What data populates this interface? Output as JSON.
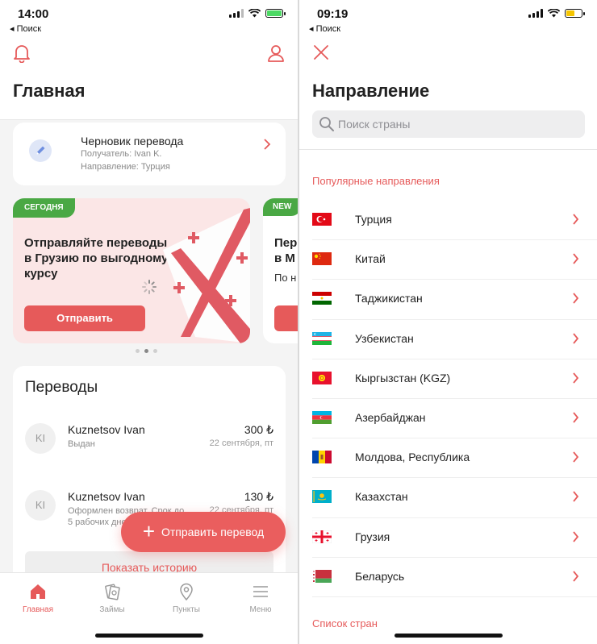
{
  "colors": {
    "accent": "#e65a5a",
    "green_badge": "#4aa844",
    "muted": "#8a8a8a"
  },
  "left": {
    "status": {
      "time": "14:00",
      "back": "◂ Поиск"
    },
    "header": {
      "title": "Главная"
    },
    "draft": {
      "title": "Черновик перевода",
      "recipient": "Получатель: Ivan K.",
      "direction": "Направление: Турция"
    },
    "promo": {
      "badge": "СЕГОДНЯ",
      "text": "Отправляйте переводы в Грузию по выгодному курсу",
      "button": "Отправить"
    },
    "promo_next": {
      "badge": "NEW",
      "line1": "Пер",
      "line2": "в М",
      "line3": "По н"
    },
    "carousel": {
      "page": 2,
      "total": 3
    },
    "transfers": {
      "title": "Переводы",
      "rows": [
        {
          "initials": "KI",
          "name": "Kuznetsov Ivan",
          "status": "Выдан",
          "amount": "300 ₺",
          "date": "22 сентября, пт"
        },
        {
          "initials": "KI",
          "name": "Kuznetsov Ivan",
          "status": "Оформлен возврат. Срок до 5 рабочих дней",
          "amount": "130 ₺",
          "date": "22 сентября, пт"
        }
      ],
      "history_button": "Показать историю"
    },
    "fab": {
      "label": "Отправить перевод"
    },
    "tabs": [
      {
        "label": "Главная",
        "icon": "home-icon"
      },
      {
        "label": "Займы",
        "icon": "loans-icon"
      },
      {
        "label": "Пункты",
        "icon": "location-icon"
      },
      {
        "label": "Меню",
        "icon": "menu-icon"
      }
    ]
  },
  "right": {
    "status": {
      "time": "09:19",
      "back": "◂ Поиск"
    },
    "title": "Направление",
    "search": {
      "placeholder": "Поиск страны",
      "value": ""
    },
    "popular_heading": "Популярные направления",
    "countries": [
      {
        "name": "Турция",
        "flag": "turkey-flag"
      },
      {
        "name": "Китай",
        "flag": "china-flag"
      },
      {
        "name": "Таджикистан",
        "flag": "tajikistan-flag"
      },
      {
        "name": "Узбекистан",
        "flag": "uzbekistan-flag"
      },
      {
        "name": "Кыргызстан (KGZ)",
        "flag": "kyrgyzstan-flag"
      },
      {
        "name": "Азербайджан",
        "flag": "azerbaijan-flag"
      },
      {
        "name": "Молдова, Республика",
        "flag": "moldova-flag"
      },
      {
        "name": "Казахстан",
        "flag": "kazakhstan-flag"
      },
      {
        "name": "Грузия",
        "flag": "georgia-flag"
      },
      {
        "name": "Беларусь",
        "flag": "belarus-flag"
      }
    ],
    "list_heading": "Список стран"
  }
}
